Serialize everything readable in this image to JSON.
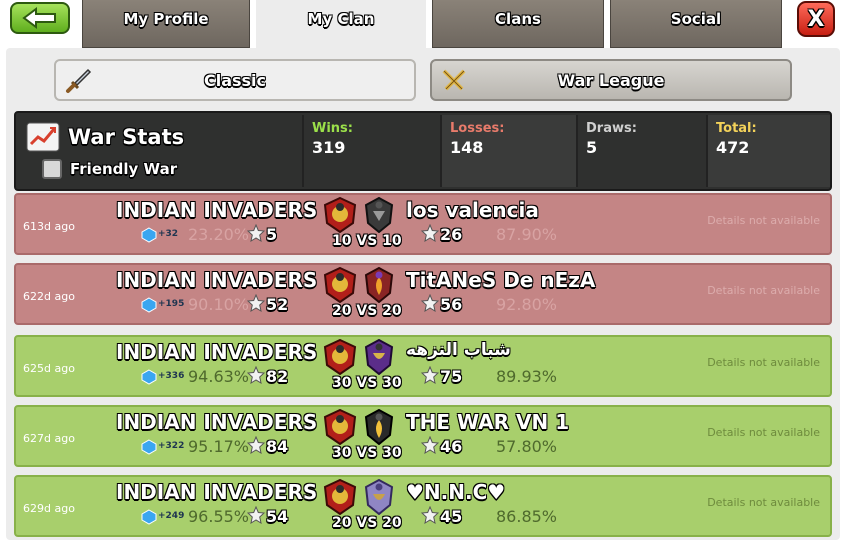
{
  "nav": {
    "tabs": [
      {
        "label": "My Profile",
        "active": false
      },
      {
        "label": "My Clan",
        "active": true
      },
      {
        "label": "Clans",
        "active": false
      },
      {
        "label": "Social",
        "active": false
      }
    ],
    "back_icon": "arrow-left-icon",
    "close_label": "X"
  },
  "modes": [
    {
      "label": "Classic",
      "icon": "sword-icon",
      "active": true
    },
    {
      "label": "War League",
      "icon": "crossed-swords-icon",
      "active": false
    }
  ],
  "stats": {
    "title": "War Stats",
    "friendly_label": "Friendly War",
    "friendly_checked": false,
    "wins_label": "Wins:",
    "wins": "319",
    "losses_label": "Losses:",
    "losses": "148",
    "draws_label": "Draws:",
    "draws": "5",
    "total_label": "Total:",
    "total": "472"
  },
  "colors": {
    "loss_row": "#c48585",
    "win_row": "#a8cf6c",
    "wins_label": "#9be04a",
    "losses_label": "#e87b6b",
    "total_label": "#f3d25a"
  },
  "wars": [
    {
      "result": "loss",
      "ago": "613d ago",
      "clan": "INDIAN INVADERS",
      "opponent": "los valencia",
      "xp": "+32",
      "our_pct": "23.20%",
      "our_stars": "5",
      "opp_stars": "26",
      "opp_pct": "87.90%",
      "vs": "10 VS 10",
      "details": "Details not available"
    },
    {
      "result": "loss",
      "ago": "622d ago",
      "clan": "INDIAN INVADERS",
      "opponent": "TitANeS De nEzA",
      "xp": "+195",
      "our_pct": "90.10%",
      "our_stars": "52",
      "opp_stars": "56",
      "opp_pct": "92.80%",
      "vs": "20 VS 20",
      "details": "Details not available"
    },
    {
      "result": "win",
      "ago": "625d ago",
      "clan": "INDIAN INVADERS",
      "opponent": "شباب النزهه",
      "xp": "+336",
      "our_pct": "94.63%",
      "our_stars": "82",
      "opp_stars": "75",
      "opp_pct": "89.93%",
      "vs": "30 VS 30",
      "details": "Details not available"
    },
    {
      "result": "win",
      "ago": "627d ago",
      "clan": "INDIAN INVADERS",
      "opponent": "THE WAR VN 1",
      "xp": "+322",
      "our_pct": "95.17%",
      "our_stars": "84",
      "opp_stars": "46",
      "opp_pct": "57.80%",
      "vs": "30 VS 30",
      "details": "Details not available"
    },
    {
      "result": "win",
      "ago": "629d ago",
      "clan": "INDIAN INVADERS",
      "opponent": "♥N.N.C♥",
      "xp": "+249",
      "our_pct": "96.55%",
      "our_stars": "54",
      "opp_stars": "45",
      "opp_pct": "86.85%",
      "vs": "20 VS 20",
      "details": "Details not available"
    }
  ]
}
